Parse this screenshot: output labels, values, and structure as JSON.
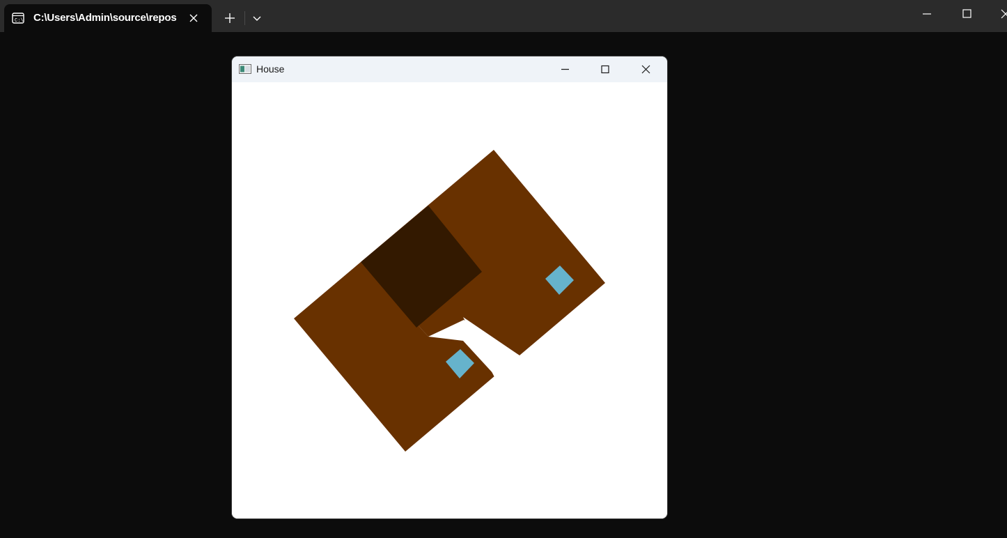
{
  "terminal": {
    "tab_title": "C:\\Users\\Admin\\source\\repos",
    "icons": {
      "tab_icon": "terminal-icon",
      "tab_close": "close-icon",
      "new_tab": "plus-icon",
      "dropdown": "chevron-down-icon",
      "minimize": "minimize-icon",
      "maximize": "maximize-icon",
      "close": "close-icon"
    },
    "colors": {
      "titlebar": "#2b2b2b",
      "background": "#0c0c0c"
    }
  },
  "house_window": {
    "title": "House",
    "icons": {
      "app": "app-window-icon",
      "minimize": "minimize-icon",
      "maximize": "maximize-icon",
      "close": "close-icon"
    },
    "colors": {
      "titlebar": "#eff3f8",
      "canvas": "#ffffff"
    },
    "drawing": {
      "shapes": [
        "house-body-left",
        "house-body-right",
        "door",
        "window-left",
        "window-right"
      ],
      "colors": {
        "body": "#683100",
        "door": "#331900",
        "window": "#66b3cc"
      }
    }
  }
}
